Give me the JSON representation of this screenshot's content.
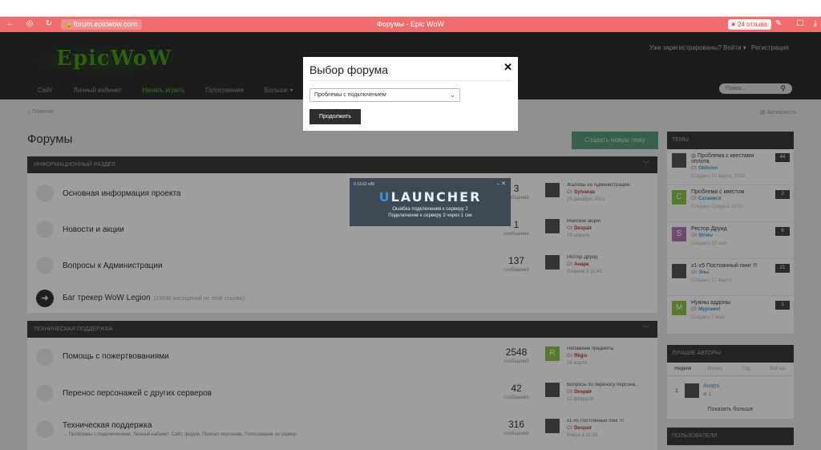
{
  "browser": {
    "url": "forum.epicwow.com",
    "page_title": "Форумы - Epic WoW",
    "reviews": "24 отзыва"
  },
  "header": {
    "logo": "EpicWoW",
    "login": "Уже зарегистрированы? Войти ▾",
    "register": "Регистрация",
    "nav": [
      "Сайт",
      "Личный кабинет",
      "Начать играть",
      "Голосование",
      "Больше ▾"
    ],
    "search_placeholder": "Поиск..."
  },
  "content": {
    "breadcrumb_home": "Главная",
    "breadcrumb_nav": "Активность",
    "page_title": "Форумы",
    "new_topic": "Создать новую тему",
    "sections": [
      {
        "title": "ИНФОРМАЦИОННЫЙ РАЗДЕЛ",
        "forums": [
          {
            "title": "Основная информация проекта",
            "count": "3",
            "count_label": "сообщений",
            "last_title": "Жалобы на Администрацию",
            "last_by_prefix": "От",
            "last_by": "Sylvanas",
            "last_date": "29 декабря, 2021"
          },
          {
            "title": "Новости и акции",
            "count": "1",
            "count_label": "сообщения",
            "last_title": "Майские акции",
            "last_by_prefix": "От",
            "last_by": "Despair",
            "last_date": "29 апреля"
          },
          {
            "title": "Вопросы к Администрации",
            "count": "137",
            "count_label": "сообщений",
            "last_title": "Рестор Друид",
            "last_by_prefix": "От",
            "last_by": "Анара",
            "last_date": "Вторник в 11:43"
          },
          {
            "title": "Баг трекер WoW Legion",
            "extra": "(23830 посещений по этой ссылке)"
          }
        ]
      },
      {
        "title": "ТЕХНИЧЕСКАЯ ПОДДЕРЖКА",
        "forums": [
          {
            "title": "Помощь с пожертвованиями",
            "count": "2548",
            "count_label": "сообщений",
            "last_avatar": "R",
            "last_title": "Непамеме предметы",
            "last_by_prefix": "От",
            "last_by": "Rkgis",
            "last_date": "29 марта"
          },
          {
            "title": "Перенос персонажей с других серверов",
            "count": "42",
            "count_label": "сообщения",
            "last_title": "Вопросы по переносу персона...",
            "last_by_prefix": "От",
            "last_by": "Despair",
            "last_date": "12 февраля"
          },
          {
            "title": "Техническая поддержка",
            "subforums": "→ Проблемы с подключением,  Личный кабинет,  Сайт, форум,  Пропал персонаж,  Голосование за сервер",
            "count": "316",
            "count_label": "сообщений",
            "last_title": "х1-х5 Постоянный пинг !!!",
            "last_by_prefix": "От",
            "last_by": "Despair",
            "last_date": "Вчера в 11:38"
          }
        ]
      }
    ]
  },
  "sidebar": {
    "topics_title": "ТЕМЫ",
    "topics": [
      {
        "avatar": "",
        "title": "◎ Проблема с квестами оплота",
        "by_prefix": "От",
        "by": "Oblivion",
        "date": "Создано 23 марта, 2018",
        "count": "44"
      },
      {
        "avatar": "C",
        "title": "Проблема с квестом",
        "by_prefix": "От",
        "by": "Сатанисл",
        "date": "Создано Среда в 19:00",
        "count": "2"
      },
      {
        "avatar": "S",
        "title": "Рестор Друид",
        "by_prefix": "От",
        "by": "ShVev",
        "date": "Создано 18 мая",
        "count": "6"
      },
      {
        "avatar": "",
        "title": "х1-х5 Постоянный пинг !!!",
        "by_prefix": "От",
        "by": "Элы",
        "date": "Создано 27 марта",
        "count": "21"
      },
      {
        "avatar": "M",
        "title": "Нужны аддоны",
        "by_prefix": "От",
        "by": "Myprawel",
        "date": "Создано 7 мая",
        "count": "1"
      }
    ],
    "authors_title": "ЛУЧШИЕ АВТОРЫ",
    "author_tabs": [
      "Неделя",
      "Месяц",
      "Год",
      "Всё вр."
    ],
    "top_author": {
      "rank": "1",
      "name": "Анара",
      "score": "1"
    },
    "show_more": "Показать больше",
    "users_title": "ПОЛЬЗОВАТЕЛИ"
  },
  "modal": {
    "title": "Выбор форума",
    "close": "✕",
    "selected": "Проблемы с подключением",
    "submit": "Продолжить"
  },
  "launcher": {
    "version": "0.33.62 x86",
    "brand_u": "U",
    "brand_rest": "LAUNCHER",
    "message1": "Ошибка подключения к серверу 2",
    "message2": "Подключение к серверу 3 через 1 сек"
  },
  "colors": {
    "browser_bar": "#f06d6d",
    "accent_green": "#5bbf3a",
    "launcher_blue": "#3a8ed8"
  }
}
